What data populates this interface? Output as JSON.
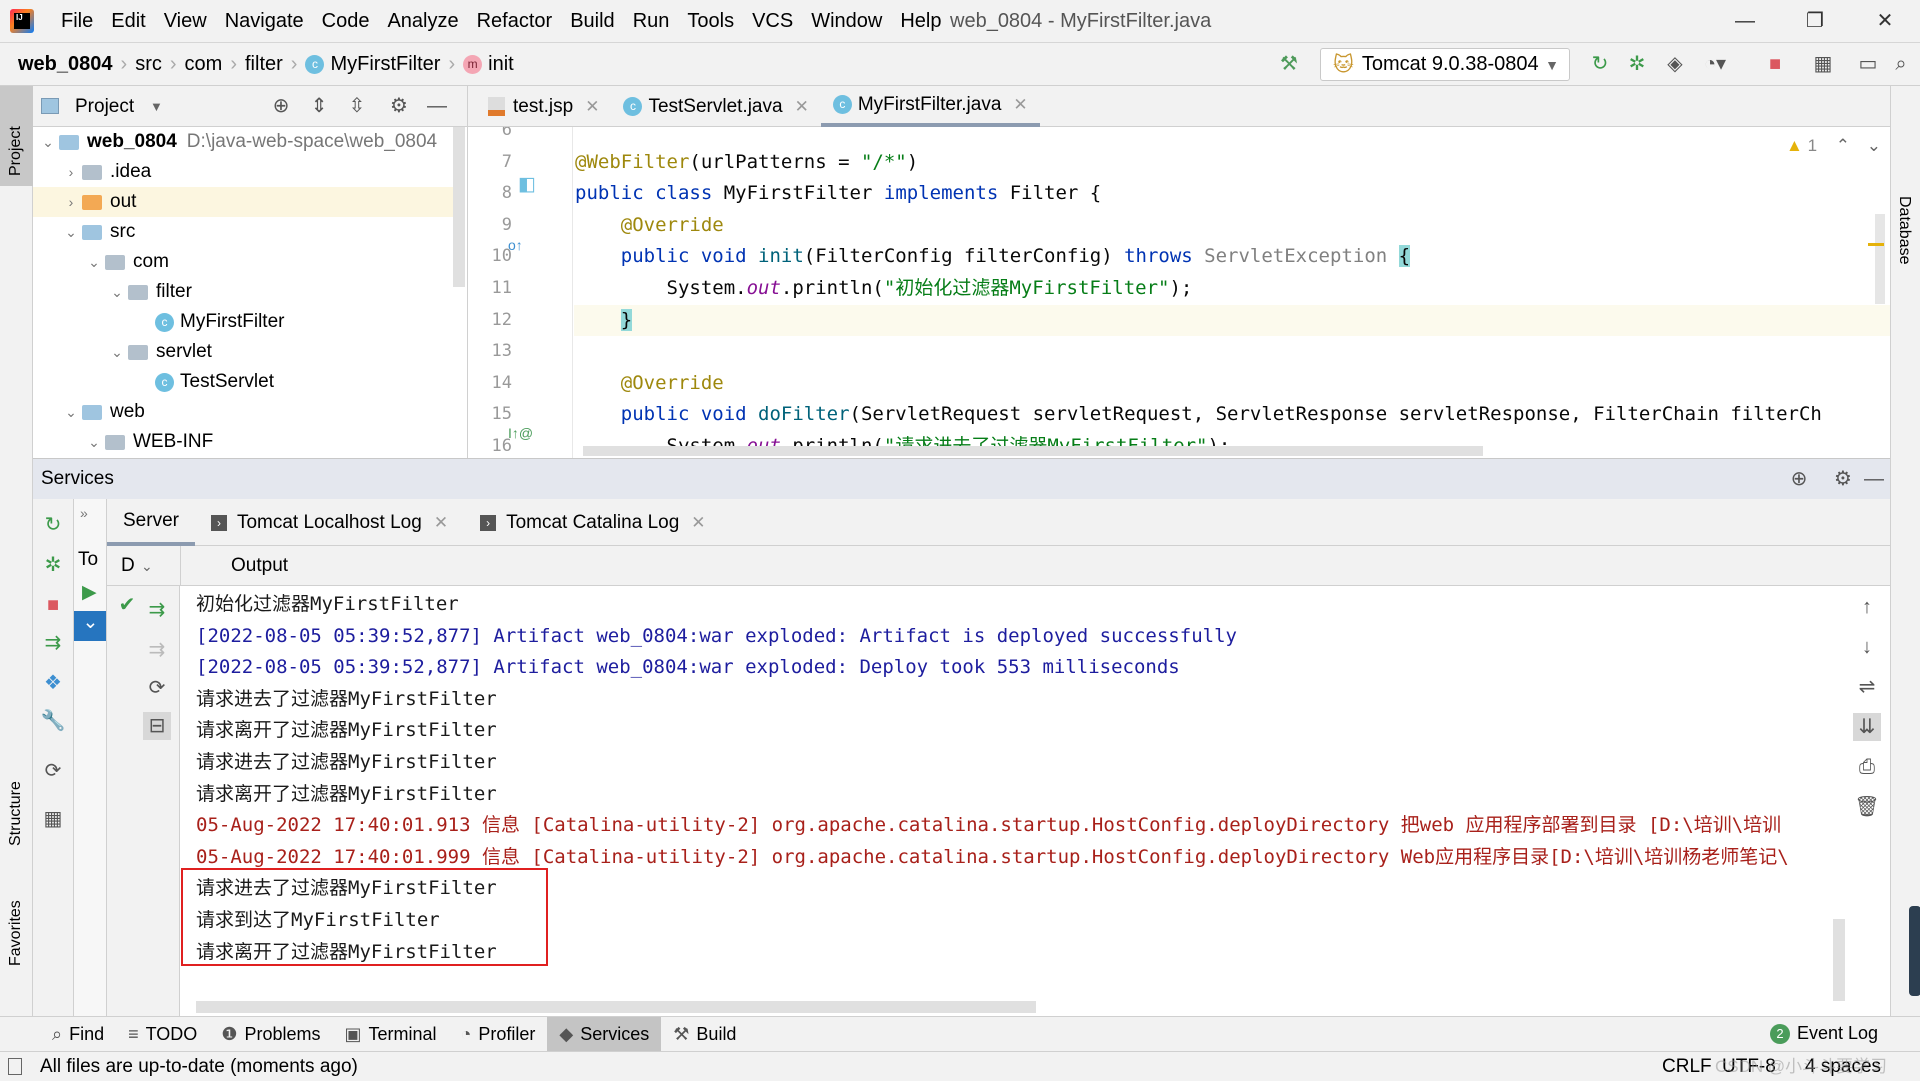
{
  "window": {
    "title": "web_0804 - MyFirstFilter.java",
    "minimize": "—",
    "restore": "❐",
    "close": "✕"
  },
  "menu": [
    "File",
    "Edit",
    "View",
    "Navigate",
    "Code",
    "Analyze",
    "Refactor",
    "Build",
    "Run",
    "Tools",
    "VCS",
    "Window",
    "Help"
  ],
  "breadcrumb": {
    "project": "web_0804",
    "items": [
      "src",
      "com",
      "filter"
    ],
    "class": "MyFirstFilter",
    "method": "init",
    "class_badge": "c",
    "method_badge": "m"
  },
  "run_config": {
    "label": "Tomcat 9.0.38-0804"
  },
  "left_stripe": {
    "project": "Project",
    "structure": "Structure",
    "favorites": "Favorites"
  },
  "right_stripe": {
    "database": "Database"
  },
  "project_panel": {
    "title": "Project",
    "tree": [
      {
        "label": "web_0804",
        "extra": "D:\\java-web-space\\web_0804",
        "level": 0,
        "expanded": true,
        "icon": "folder-module",
        "bold": true
      },
      {
        "label": ".idea",
        "level": 1,
        "expanded": false,
        "icon": "folder"
      },
      {
        "label": "out",
        "level": 1,
        "expanded": false,
        "icon": "folder-excluded",
        "selected": true
      },
      {
        "label": "src",
        "level": 1,
        "expanded": true,
        "icon": "folder-source"
      },
      {
        "label": "com",
        "level": 2,
        "expanded": true,
        "icon": "package"
      },
      {
        "label": "filter",
        "level": 3,
        "expanded": true,
        "icon": "package"
      },
      {
        "label": "MyFirstFilter",
        "level": 4,
        "icon": "class"
      },
      {
        "label": "servlet",
        "level": 3,
        "expanded": true,
        "icon": "package"
      },
      {
        "label": "TestServlet",
        "level": 4,
        "icon": "class"
      },
      {
        "label": "web",
        "level": 1,
        "expanded": true,
        "icon": "folder-web"
      },
      {
        "label": "WEB-INF",
        "level": 2,
        "expanded": true,
        "icon": "folder"
      }
    ]
  },
  "editor": {
    "tabs": [
      {
        "label": "test.jsp",
        "icon": "jsp"
      },
      {
        "label": "TestServlet.java",
        "icon": "class"
      },
      {
        "label": "MyFirstFilter.java",
        "icon": "class",
        "active": true
      }
    ],
    "warnings": "1",
    "lines": [
      {
        "n": "6",
        "tokens": []
      },
      {
        "n": "7",
        "tokens": [
          {
            "t": "@WebFilter",
            "c": "a"
          },
          {
            "t": "(urlPatterns = ",
            "c": "p"
          },
          {
            "t": "\"/*\"",
            "c": "s"
          },
          {
            "t": ")",
            "c": "p"
          }
        ]
      },
      {
        "n": "8",
        "tokens": [
          {
            "t": "public class ",
            "c": "k"
          },
          {
            "t": "MyFirstFilter ",
            "c": "p"
          },
          {
            "t": "implements ",
            "c": "k"
          },
          {
            "t": "Filter {",
            "c": "p"
          }
        ]
      },
      {
        "n": "9",
        "tokens": [
          {
            "t": "    @Override",
            "c": "a"
          }
        ]
      },
      {
        "n": "10",
        "tokens": [
          {
            "t": "    public void ",
            "c": "k"
          },
          {
            "t": "init",
            "c": "m"
          },
          {
            "t": "(FilterConfig filterConfig) ",
            "c": "p"
          },
          {
            "t": "throws ",
            "c": "k"
          },
          {
            "t": "ServletException ",
            "c": "g"
          },
          {
            "t": "{",
            "c": "p brace"
          }
        ]
      },
      {
        "n": "11",
        "tokens": [
          {
            "t": "        System.",
            "c": "p"
          },
          {
            "t": "out",
            "c": "o"
          },
          {
            "t": ".println(",
            "c": "p"
          },
          {
            "t": "\"初始化过滤器MyFirstFilter\"",
            "c": "s"
          },
          {
            "t": ");",
            "c": "p"
          }
        ]
      },
      {
        "n": "12",
        "current": true,
        "tokens": [
          {
            "t": "    ",
            "c": "p"
          },
          {
            "t": "}",
            "c": "p brace"
          }
        ]
      },
      {
        "n": "13",
        "tokens": []
      },
      {
        "n": "14",
        "tokens": [
          {
            "t": "    @Override",
            "c": "a"
          }
        ]
      },
      {
        "n": "15",
        "tokens": [
          {
            "t": "    public void ",
            "c": "k"
          },
          {
            "t": "doFilter",
            "c": "m"
          },
          {
            "t": "(ServletRequest servletRequest, ServletResponse servletResponse, FilterChain filterCh",
            "c": "p"
          }
        ]
      },
      {
        "n": "16",
        "tokens": [
          {
            "t": "        System.",
            "c": "p"
          },
          {
            "t": "out",
            "c": "o"
          },
          {
            "t": ".println(",
            "c": "p"
          },
          {
            "t": "\"请求进去了过滤器MyFirstFilter\"",
            "c": "s"
          },
          {
            "t": ");",
            "c": "p"
          }
        ]
      }
    ]
  },
  "services": {
    "title": "Services",
    "tabs": [
      {
        "label": "Server",
        "active": true
      },
      {
        "label": "Tomcat Localhost Log",
        "closable": true
      },
      {
        "label": "Tomcat Catalina Log",
        "closable": true
      }
    ],
    "tree_label": "To",
    "output_header": {
      "col": "D",
      "title": "Output"
    },
    "output": [
      {
        "text": "初始化过滤器MyFirstFilter",
        "kind": "normal"
      },
      {
        "text": "[2022-08-05 05:39:52,877] Artifact web_0804:war exploded: Artifact is deployed successfully",
        "kind": "info"
      },
      {
        "text": "[2022-08-05 05:39:52,877] Artifact web_0804:war exploded: Deploy took 553 milliseconds",
        "kind": "info"
      },
      {
        "text": "请求进去了过滤器MyFirstFilter",
        "kind": "normal"
      },
      {
        "text": "请求离开了过滤器MyFirstFilter",
        "kind": "normal"
      },
      {
        "text": "请求进去了过滤器MyFirstFilter",
        "kind": "normal"
      },
      {
        "text": "请求离开了过滤器MyFirstFilter",
        "kind": "normal"
      },
      {
        "text": "05-Aug-2022 17:40:01.913 信息 [Catalina-utility-2] org.apache.catalina.startup.HostConfig.deployDirectory 把web 应用程序部署到目录 [D:\\培训\\培训",
        "kind": "err"
      },
      {
        "text": "05-Aug-2022 17:40:01.999 信息 [Catalina-utility-2] org.apache.catalina.startup.HostConfig.deployDirectory Web应用程序目录[D:\\培训\\培训杨老师笔记\\",
        "kind": "err"
      },
      {
        "text": "请求进去了过滤器MyFirstFilter",
        "kind": "normal",
        "highlighted": true
      },
      {
        "text": "请求到达了MyFirstFilter",
        "kind": "normal",
        "highlighted": true
      },
      {
        "text": "请求离开了过滤器MyFirstFilter",
        "kind": "normal",
        "highlighted": true
      }
    ]
  },
  "tool_windows": [
    {
      "label": "Find",
      "icon": "search"
    },
    {
      "label": "TODO",
      "icon": "list"
    },
    {
      "label": "Problems",
      "icon": "info"
    },
    {
      "label": "Terminal",
      "icon": "terminal"
    },
    {
      "label": "Profiler",
      "icon": "profiler"
    },
    {
      "label": "Services",
      "icon": "services",
      "active": true
    },
    {
      "label": "Build",
      "icon": "hammer"
    }
  ],
  "event_log": {
    "label": "Event Log",
    "count": "2"
  },
  "status": {
    "message": "All files are up-to-date (moments ago)",
    "line_sep": "CRLF",
    "encoding": "UTF-8",
    "indent": "4 spaces",
    "watermark": "CSDN @小斗斗要学习"
  },
  "colors": {
    "keyword": "#0033b3",
    "annotation": "#9e880d",
    "string": "#067d17",
    "info": "#1d1d9e",
    "error": "#a8201a",
    "highlight_box": "#e02020"
  }
}
